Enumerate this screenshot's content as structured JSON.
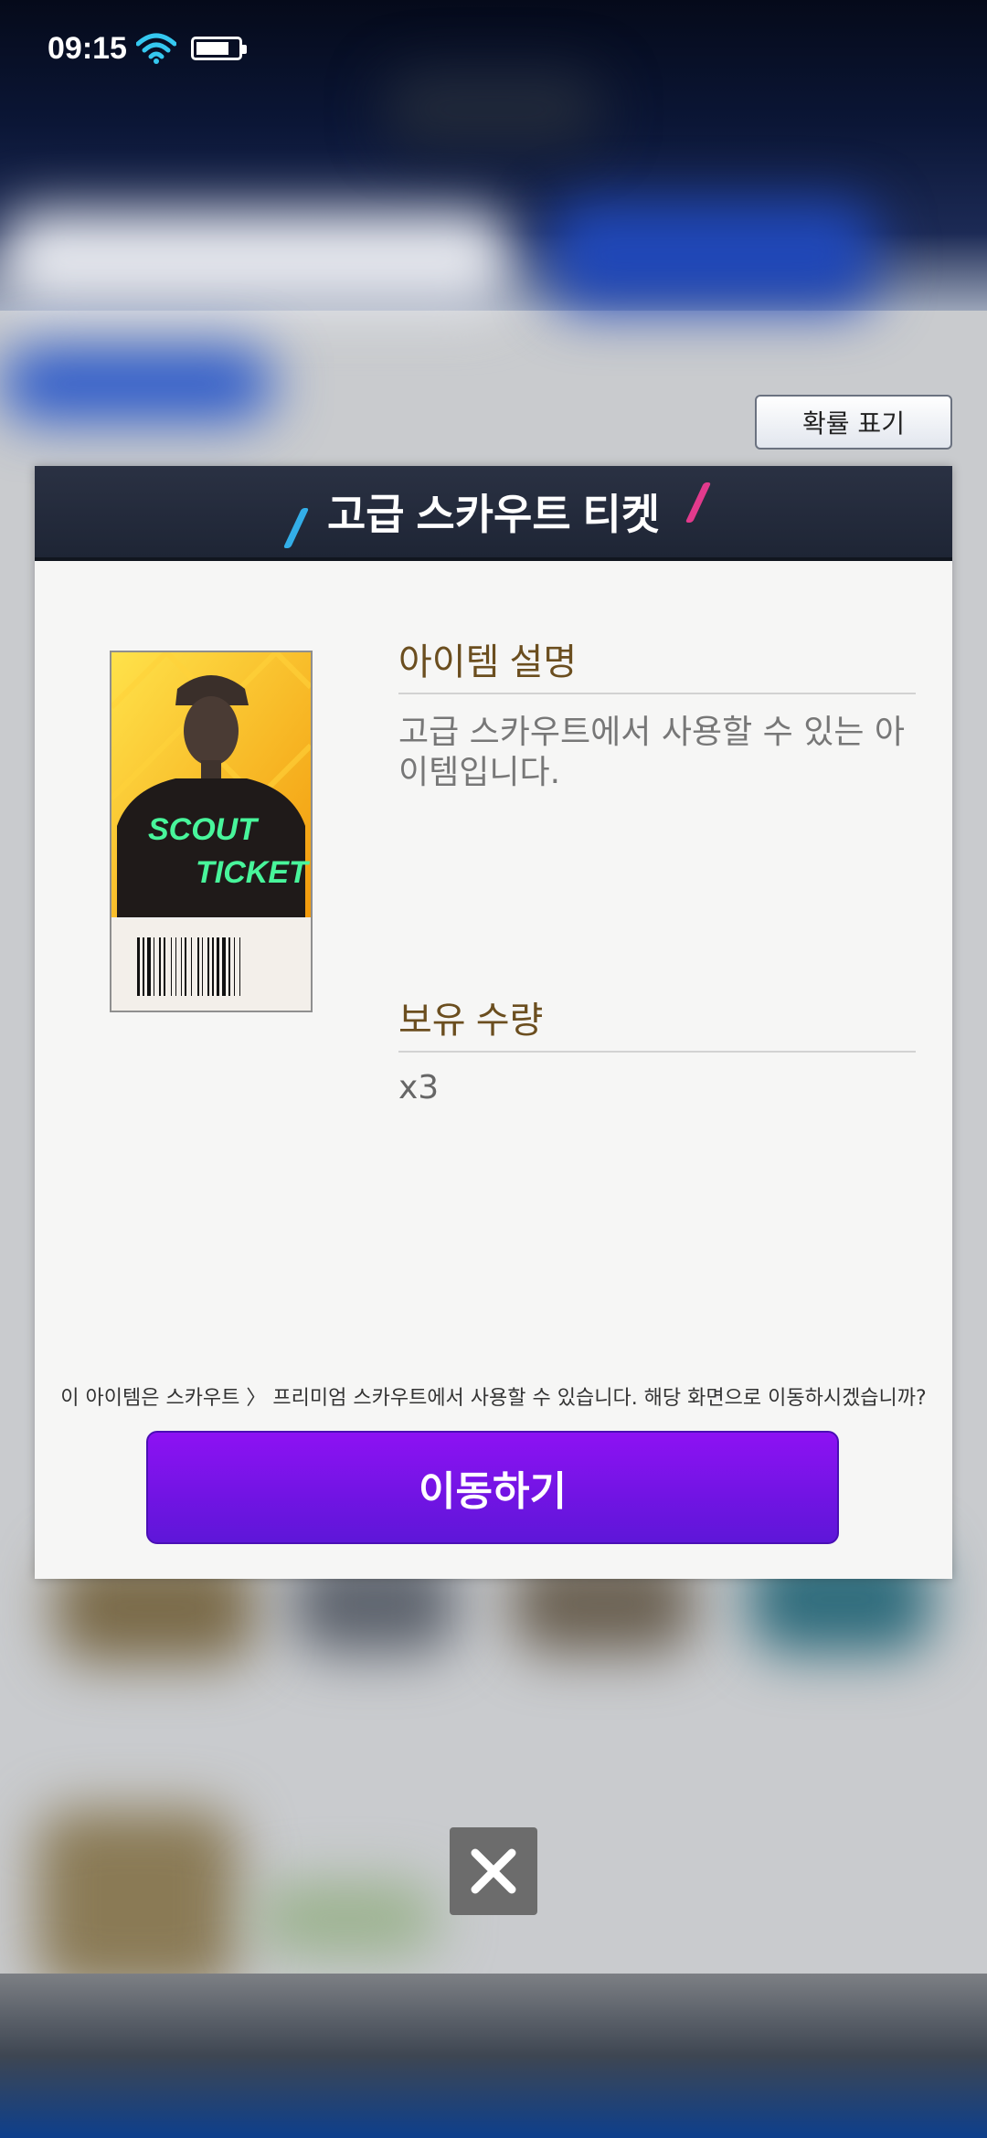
{
  "status_bar": {
    "time": "09:15",
    "battery_level": 0.8
  },
  "probability_button": {
    "label": "확률 표기"
  },
  "dialog": {
    "title": "고급 스카우트 티켓",
    "ticket": {
      "line1": "SCOUT",
      "line2": "TICKET"
    },
    "description_title": "아이템 설명",
    "description_text": "고급 스카우트에서 사용할 수 있는 아이템입니다.",
    "quantity_title": "보유 수량",
    "quantity_value": "x3",
    "note": "이 아이템은 스카우트 〉 프리미엄 스카우트에서 사용할 수 있습니다. 해당 화면으로 이동하시겠습니까?",
    "go_button": "이동하기"
  },
  "colors": {
    "header_bg": "#232a3b",
    "go_button": "#7a14ea",
    "section_title": "#6b4e1f",
    "accent_blue": "#33aee8",
    "accent_pink": "#e23a8c"
  },
  "icons": {
    "wifi": "wifi-icon",
    "battery": "battery-icon",
    "close": "close-icon"
  }
}
